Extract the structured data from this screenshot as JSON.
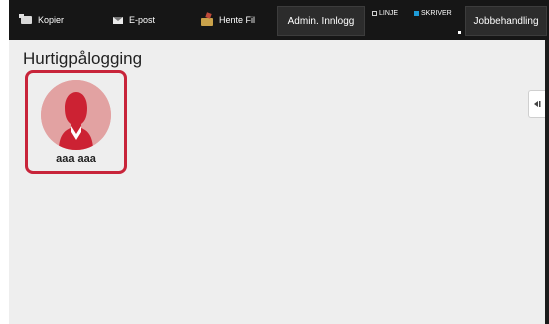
{
  "toolbar": {
    "tabs": [
      {
        "label": "Kopier",
        "icon": "copier-icon"
      },
      {
        "label": "E-post",
        "icon": "mail-icon"
      },
      {
        "label": "Hente Fil",
        "icon": "folder-icon"
      }
    ],
    "admin_login_label": "Admin. Innlogg",
    "status_line_label": "LINJE",
    "status_printer_label": "SKRIVER",
    "job_status_label": "Jobbehandling"
  },
  "main": {
    "title": "Hurtigpålogging",
    "users": [
      {
        "name": "aaa aaa"
      }
    ]
  },
  "colors": {
    "selection_border": "#c8243a",
    "printer_status": "#1e9bd7",
    "avatar_background": "#e2a2a2",
    "avatar_figure": "#cc2233"
  }
}
